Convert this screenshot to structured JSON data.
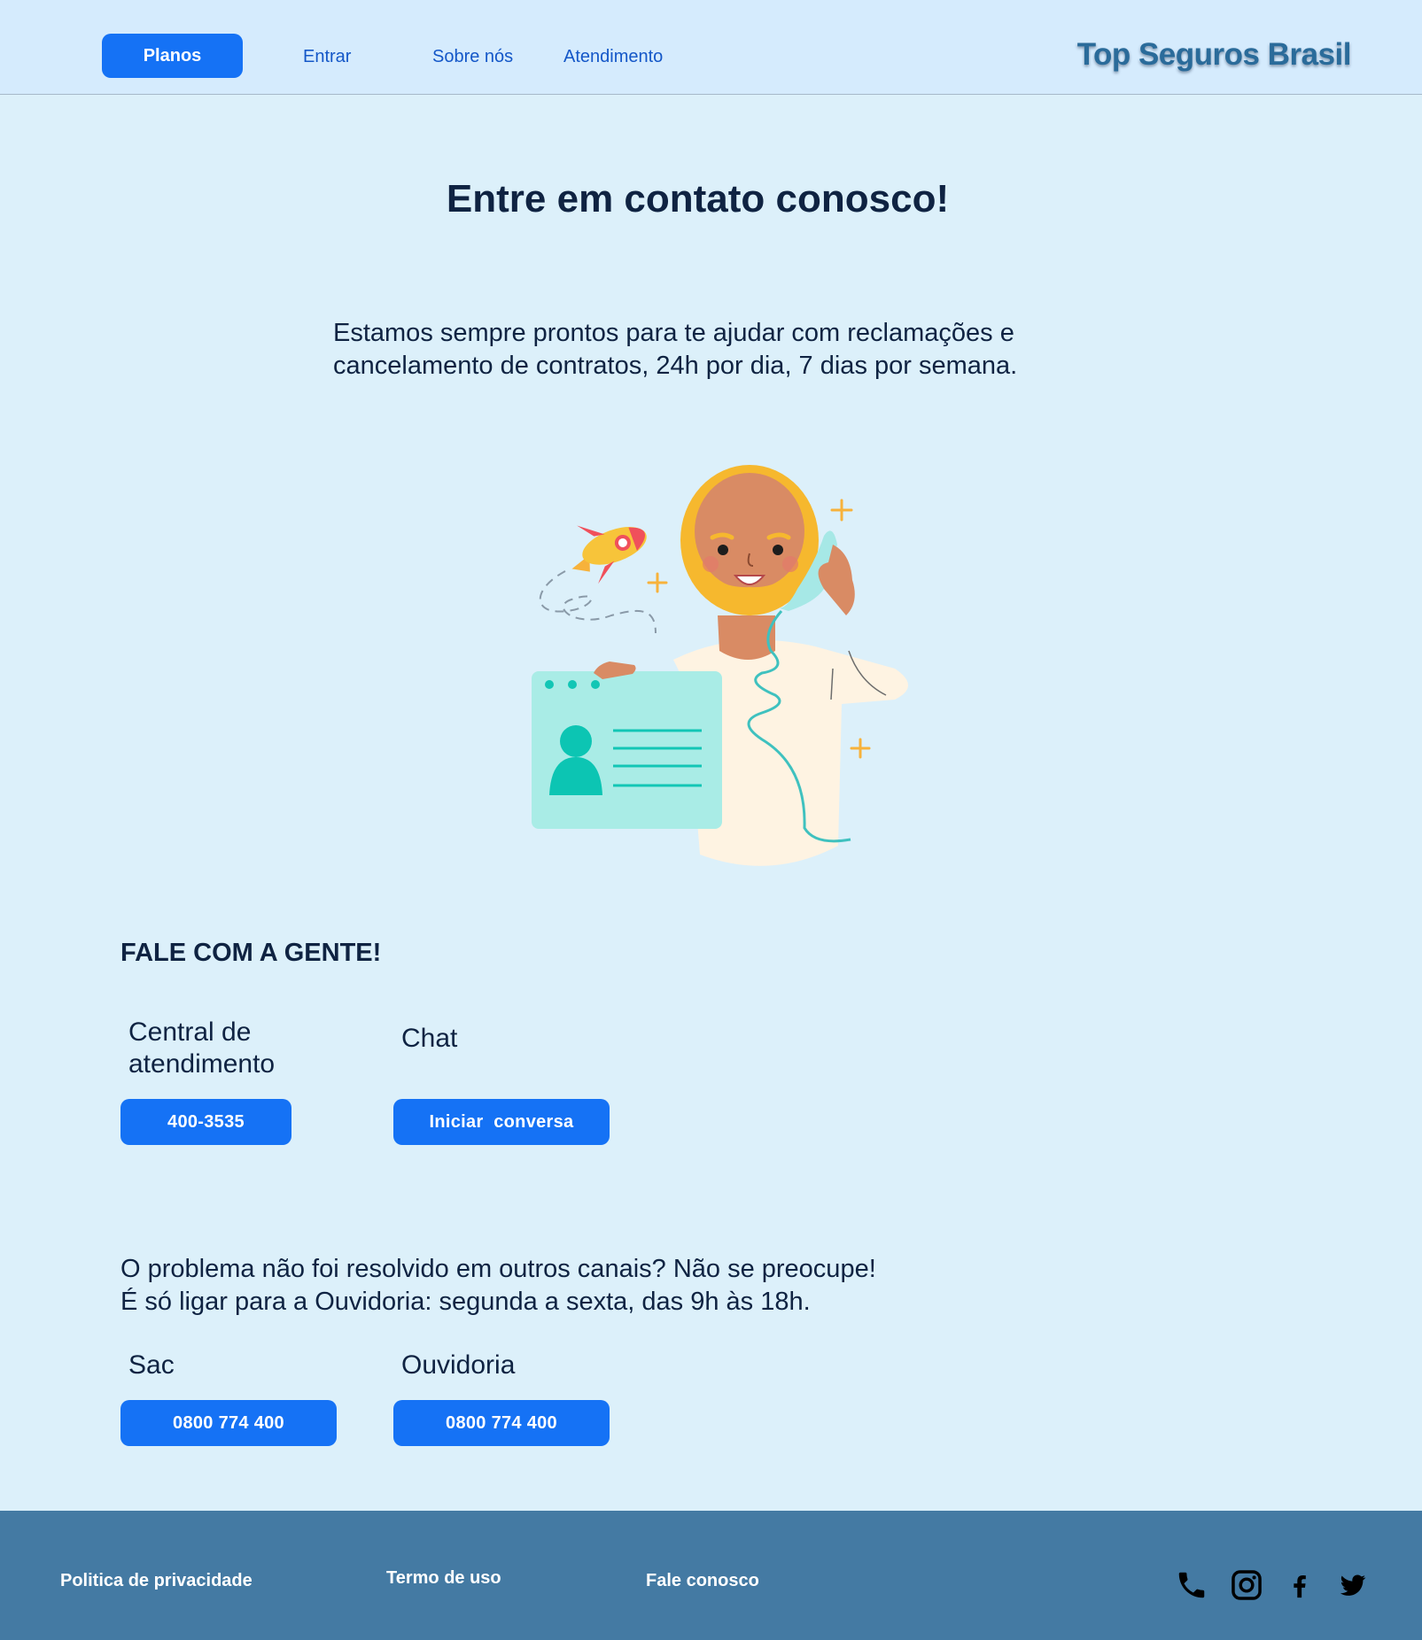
{
  "header": {
    "nav": {
      "plans_label": "Planos",
      "login_label": "Entrar",
      "about_label": "Sobre nós",
      "support_label": "Atendimento"
    },
    "brand": "Top Seguros Brasil"
  },
  "main": {
    "title": "Entre em contato conosco!",
    "intro_line1": "Estamos sempre prontos para te ajudar com reclamações e",
    "intro_line2": "cancelamento de contratos, 24h por dia, 7 dias por semana.",
    "contact_heading": "FALE COM A GENTE!",
    "central": {
      "label_line1": "Central de",
      "label_line2": "atendimento",
      "button": "400-3535"
    },
    "chat": {
      "label": "Chat",
      "button": "Iniciar  conversa"
    },
    "ouvidoria_text_line1": "O problema não foi resolvido em outros canais? Não se preocupe!",
    "ouvidoria_text_line2": "É só ligar para a Ouvidoria: segunda a sexta, das 9h às 18h.",
    "sac": {
      "label": "Sac",
      "button": "0800 774 400"
    },
    "ouvidoria": {
      "label": "Ouvidoria",
      "button": "0800 774 400"
    }
  },
  "footer": {
    "privacy_label": "Politica de privacidade",
    "terms_label": "Termo de uso",
    "contact_label": "Fale conosco",
    "social_icons": [
      "phone-icon",
      "instagram-icon",
      "facebook-icon",
      "twitter-icon"
    ]
  },
  "colors": {
    "background": "#dcf0fa",
    "header_bg": "#d5ebfd",
    "accent": "#1572f5",
    "footer_bg": "#447aa3",
    "text_dark": "#0f2342"
  }
}
